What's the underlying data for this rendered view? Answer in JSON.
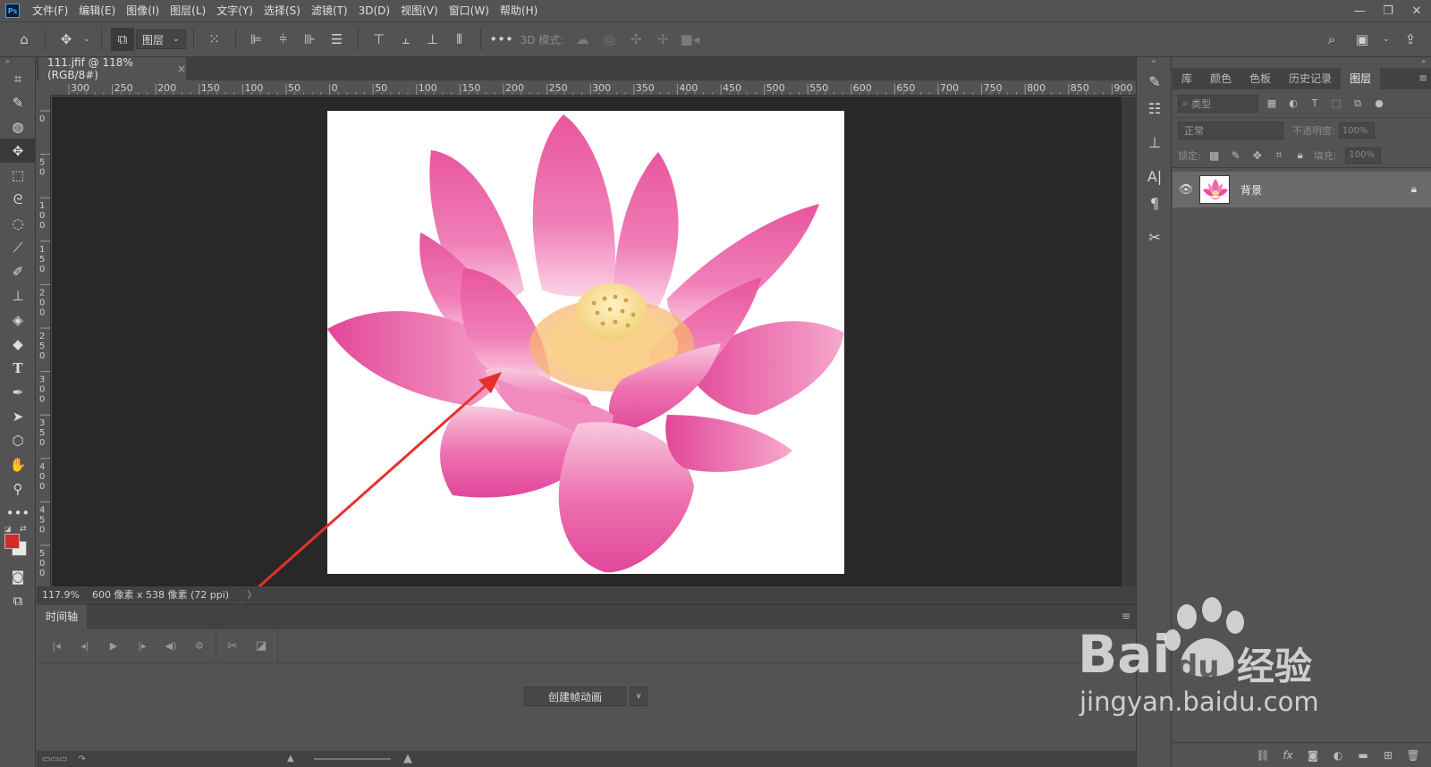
{
  "app": {
    "logo": "Ps",
    "menu": [
      "文件(F)",
      "编辑(E)",
      "图像(I)",
      "图层(L)",
      "文字(Y)",
      "选择(S)",
      "滤镜(T)",
      "3D(D)",
      "视图(V)",
      "窗口(W)",
      "帮助(H)"
    ],
    "window_controls": [
      "—",
      "❐",
      "✕"
    ]
  },
  "options_bar": {
    "layer_select_value": "图层",
    "mode_3d_label": "3D 模式:"
  },
  "document": {
    "tab_title": "111.jfif @ 118%(RGB/8#)",
    "tab_close": "×",
    "ruler_top_labels": [
      "300",
      "250",
      "200",
      "150",
      "100",
      "50",
      "0",
      "50",
      "100",
      "150",
      "200",
      "250",
      "300",
      "350",
      "400",
      "450",
      "500",
      "550",
      "600",
      "650",
      "700",
      "750",
      "800",
      "850",
      "900"
    ],
    "ruler_left_labels": [
      "0",
      "5\n0",
      "1\n0\n0",
      "1\n5\n0",
      "2\n0\n0",
      "2\n5\n0",
      "3\n0\n0",
      "3\n5\n0",
      "4\n0\n0",
      "4\n5\n0",
      "5\n0\n0"
    ],
    "zoom": "117.9%",
    "size_info": "600 像素 x 538 像素 (72 ppi)",
    "status_arrow": "〉"
  },
  "timeline": {
    "tab_label": "时间轴",
    "create_button": "创建帧动画",
    "dropdown_glyph": "∨"
  },
  "panels": {
    "tabs": [
      "库",
      "颜色",
      "色板",
      "历史记录",
      "图层"
    ],
    "active_tab": "图层",
    "filter_placeholder": "类型",
    "blend_mode": "正常",
    "opacity_label": "不透明度:",
    "opacity_value": "100%",
    "lock_label": "锁定:",
    "fill_label": "填充:",
    "fill_value": "100%",
    "layers": [
      {
        "name": "背景",
        "visible": true,
        "locked": true
      }
    ]
  },
  "watermark": {
    "brand": "Bai",
    "brand_paw": "du",
    "suffix": "经验",
    "url": "jingyan.baidu.com"
  },
  "colors": {
    "foreground": "#d42a2a",
    "background": "#e8e8e8",
    "arrow": "#e8302b",
    "accent": "#31a8ff"
  }
}
